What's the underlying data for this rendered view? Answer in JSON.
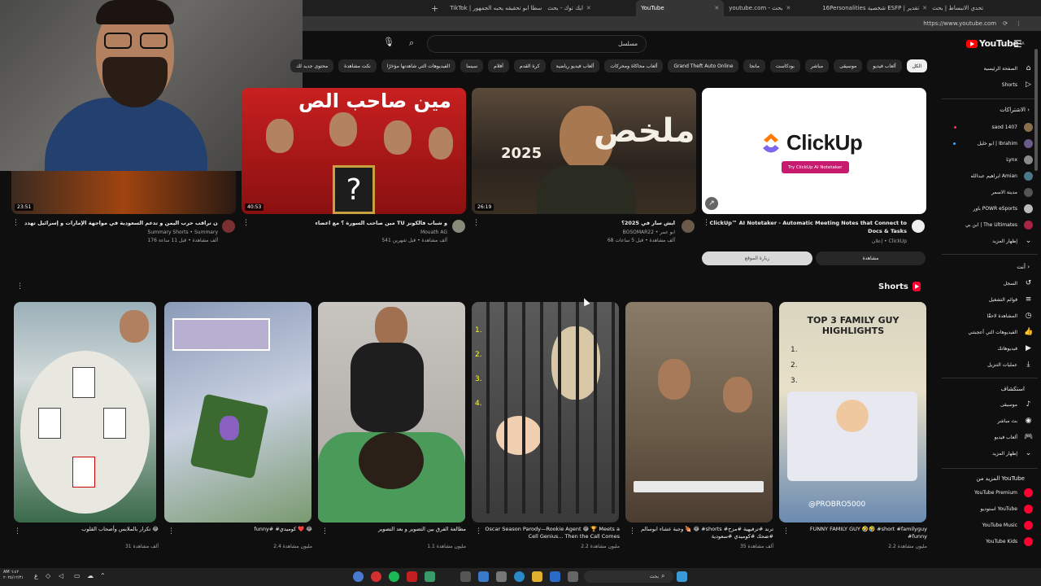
{
  "browser": {
    "tabs": [
      {
        "title": "تحدي الانبساط | بحث"
      },
      {
        "title": "16Personalities شخصية ESFP | تقدير"
      },
      {
        "title": "youtube.com - بحث"
      },
      {
        "title": "YouTube",
        "active": true
      },
      {
        "title": "ايك توك - بحث"
      },
      {
        "title": "TikTok | سطا ابو تحقيقه يحبه الجمهور"
      }
    ],
    "url": "https://www.youtube.com"
  },
  "youtube": {
    "logo_text": "YouTube",
    "logo_cc": "SA",
    "search_value": "مسلسل",
    "chips": [
      {
        "label": "الكل",
        "active": true
      },
      {
        "label": "ألعاب فيديو"
      },
      {
        "label": "موسيقى"
      },
      {
        "label": "مباشر"
      },
      {
        "label": "بودكاست"
      },
      {
        "label": "مانجا"
      },
      {
        "label": "Grand Theft Auto Online"
      },
      {
        "label": "ألعاب محاكاة ومحركات"
      },
      {
        "label": "ألعاب فيديو رياضية"
      },
      {
        "label": "كرة القدم"
      },
      {
        "label": "أفلام"
      },
      {
        "label": "سينما"
      },
      {
        "label": "الفيديوهات التي شاهدتها مؤخرًا"
      },
      {
        "label": "نكت مشاهدة"
      },
      {
        "label": "محتوى جديد لك"
      }
    ],
    "videos": [
      {
        "title": "ClickUp™ AI Notetaker - Automatic Meeting Notes that Connect to Docs & Tasks",
        "channel": "ClickUp",
        "meta": "إعلان",
        "is_ad": true,
        "ad_button": "Try ClickUp AI Notetaker",
        "cta_primary": "مشاهدة",
        "cta_secondary": "زيارة الموقع"
      },
      {
        "title": "ايش سار في 2025؟",
        "channel": "BOSOMAR22 • ابو عمر",
        "meta": "68 ألف مشاهدة • قبل 5 ساعات",
        "duration": "26:19",
        "thumb_text": "ملخص",
        "thumb_sub": "2025"
      },
      {
        "title": "مين صاحب السورة ؟ مع اعضاء TU و شباب فالكونز",
        "channel": "Mouath AG",
        "meta": "541 ألف مشاهدة • قبل شهرين",
        "duration": "40:53",
        "thumb_text": "مين صاحب الص"
      },
      {
        "title": "إيران تراقب حرب اليمن و تدعم السعودية في مواجهة الإمارات و إسرائيل تهدد",
        "channel": "Summary Shorts • Summary",
        "meta": "176 ألف مشاهدة • قبل 11 ساعة",
        "duration": "23:51"
      }
    ],
    "shorts": {
      "title": "Shorts",
      "items": [
        {
          "title": "FUNNY FAMILY GUY 🤣🤣 #short #familyguy #funny",
          "views": "2.2 مليون مشاهدة",
          "thumb_text": "TOP 3 FAMILY GUY HIGHLIGHTS",
          "handle": "@PROBRO5000"
        },
        {
          "title": "وجبة عشاء ابوسالم 🍖 😂 #shorts #ترند #ترفيهية #مزح #ضحك #كوميدي #سعودية",
          "views": "35 ألف مشاهدة"
        },
        {
          "title": "Oscar Season Parody—Rookie Agent 😂 🏆 Meets a Cell Genius... Then the Call Comes",
          "views": "2.2 مليون مشاهدة"
        },
        {
          "title": "مطالعة الفرق بين التصوير و بعد التصوير",
          "views": "1.1 مليون مشاهدة"
        },
        {
          "title": "funny# #كوميدي ❤️ 😂",
          "views": "2.4 مليون مشاهدة"
        },
        {
          "title": "تكرار بالملابس وأصحاب القلوب 😂",
          "views": "31 ألف مشاهدة"
        }
      ]
    },
    "sidebar": {
      "primary": [
        {
          "label": "الصفحة الرئيسية",
          "icon": "home-icon"
        },
        {
          "label": "Shorts",
          "icon": "shorts-icon"
        }
      ],
      "subs_title": "الاشتراكات",
      "subscriptions": [
        {
          "label": "saod 1407",
          "color": "#8a6d4b"
        },
        {
          "label": "ابو خليل | Ibrahim",
          "color": "#6b5a8a"
        },
        {
          "label": "Lynx",
          "color": "#8a8a8a"
        },
        {
          "label": "ابراهيم عبدالله Amian",
          "color": "#4a7a8a"
        },
        {
          "label": "مدينة الاسمر",
          "color": "#555555"
        },
        {
          "label": "باور POWR eSports",
          "color": "#bbbbbb"
        },
        {
          "label": "ابن بي | The Ultimates",
          "color": "#aa2244"
        }
      ],
      "show_more": "إظهار المزيد",
      "you_title": "أنت",
      "you_items": [
        {
          "label": "السجل",
          "icon": "history-icon"
        },
        {
          "label": "قوائم التشغيل",
          "icon": "playlist-icon"
        },
        {
          "label": "المشاهدة لاحقًا",
          "icon": "clock-icon"
        },
        {
          "label": "الفيديوهات التي أعجبتني",
          "icon": "like-icon"
        },
        {
          "label": "فيديوهاتك",
          "icon": "video-icon"
        },
        {
          "label": "عمليات التنزيل",
          "icon": "download-icon"
        }
      ],
      "explore_title": "استكشاف",
      "explore_items": [
        {
          "label": "موسيقى",
          "icon": "music-icon"
        },
        {
          "label": "بث مباشر",
          "icon": "live-icon"
        },
        {
          "label": "ألعاب فيديو",
          "icon": "gaming-icon"
        },
        {
          "label": "إظهار المزيد",
          "icon": "chevron-down-icon"
        }
      ],
      "more_title": "المزيد من YouTube",
      "more_items": [
        {
          "label": "YouTube Premium",
          "color": "#ff0033"
        },
        {
          "label": "استوديو YouTube",
          "color": "#ff0033"
        },
        {
          "label": "YouTube Music",
          "color": "#ff0033"
        },
        {
          "label": "YouTube Kids",
          "color": "#ff0033"
        }
      ]
    }
  },
  "taskbar": {
    "search_placeholder": "بحث",
    "time": "AM ٦:٤٢",
    "date": "٢٠٢٥/١٢/٣١"
  }
}
